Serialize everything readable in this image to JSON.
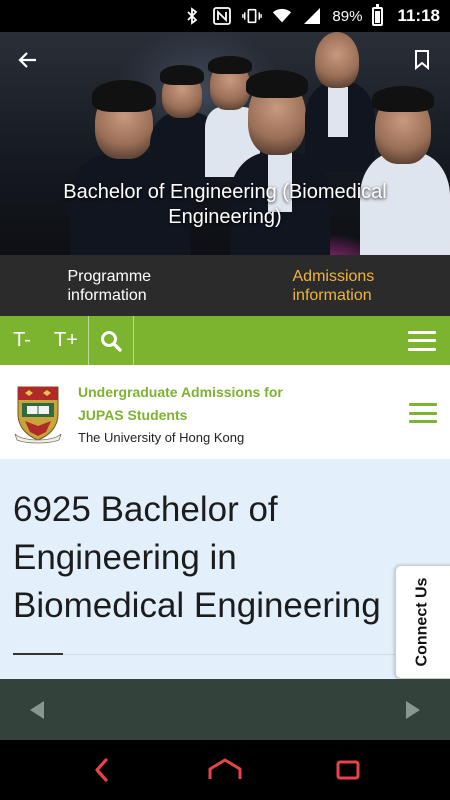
{
  "status_bar": {
    "battery": "89%",
    "time": "11:18",
    "icons": [
      "bluetooth-icon",
      "nfc-icon",
      "vibrate-icon",
      "wifi-icon",
      "signal-icon",
      "battery-icon"
    ]
  },
  "hero": {
    "title": "Bachelor of Engineering (Biomedical Engineering)",
    "back_icon": "arrow-left-icon",
    "bookmark_icon": "bookmark-icon"
  },
  "programme_tabs": [
    {
      "label": "Programme information",
      "active": false
    },
    {
      "label": "Admissions information",
      "active": true
    }
  ],
  "toolbar": {
    "text_smaller": "T-",
    "text_larger": "T+",
    "search_icon": "search-icon",
    "menu_icon": "menu-icon"
  },
  "site_header": {
    "title_line1": "Undergraduate Admissions for",
    "title_line2": "JUPAS Students",
    "subtitle": "The University of Hong Kong"
  },
  "content": {
    "heading_line1": "6925 Bachelor of",
    "heading_line2": "Engineering in",
    "heading_line3": "Biomedical Engineering"
  },
  "connect_tab": {
    "label": "Connect Us"
  },
  "colors": {
    "accent_green": "#7cb32f",
    "active_tab": "#f0b43c",
    "content_bg": "#e3f0fc",
    "browser_nav_bg": "#34423c",
    "nav_red": "#e8424a"
  }
}
